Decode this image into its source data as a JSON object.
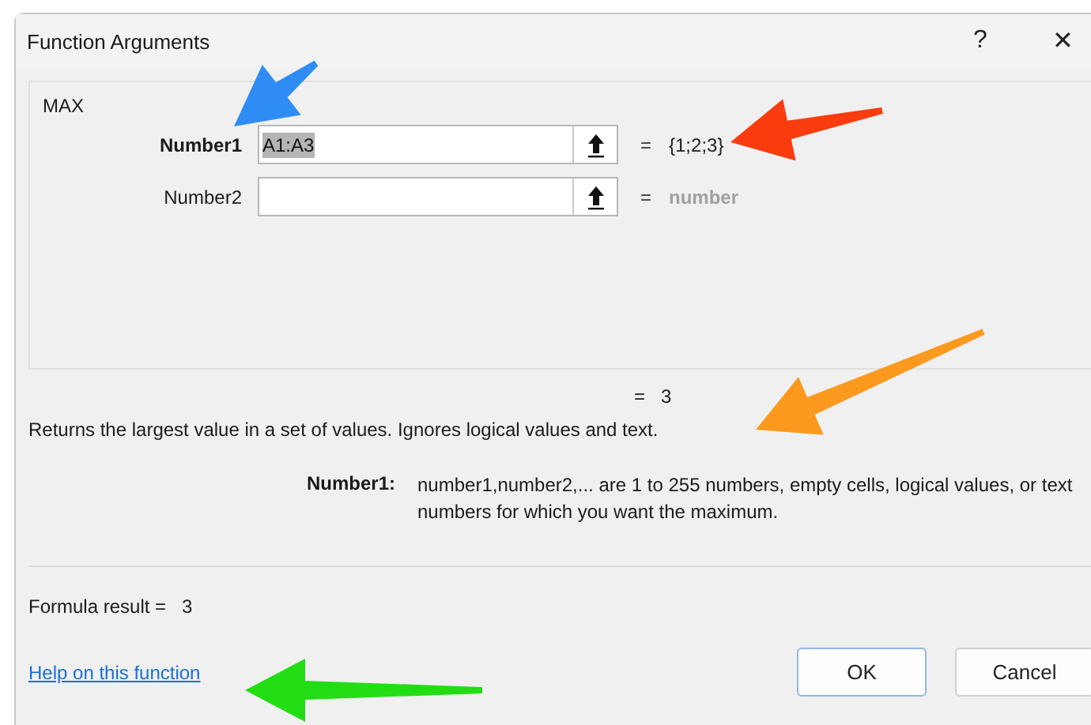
{
  "window": {
    "title": "Function Arguments",
    "help": "?",
    "close": "✕"
  },
  "function_name": "MAX",
  "arguments": [
    {
      "label": "Number1",
      "bold": true,
      "value": "A1:A3",
      "value_selected": true,
      "equals": "=",
      "result": "{1;2;3}",
      "result_muted": false
    },
    {
      "label": "Number2",
      "bold": false,
      "equals": "=",
      "result": "number",
      "result_muted": true
    }
  ],
  "result_line": {
    "equals": "=",
    "value": "3"
  },
  "description": "Returns the largest value in a set of values. Ignores logical values and text.",
  "argument_help": {
    "label": "Number1:",
    "text": "number1,number2,... are 1 to 255 numbers, empty cells, logical values, or text numbers for which you want the maximum."
  },
  "formula_result": {
    "label": "Formula result =",
    "value": "3"
  },
  "help_link": "Help on this function",
  "buttons": [
    {
      "label": "OK",
      "default": true
    },
    {
      "label": "Cancel",
      "default": false
    }
  ],
  "annotations": [
    {
      "kind": "arrow",
      "color": "#2f8cf5"
    },
    {
      "kind": "arrow",
      "color": "#fa3c0f"
    },
    {
      "kind": "arrow",
      "color": "#fb9a1e"
    },
    {
      "kind": "arrow",
      "color": "#22dd14"
    }
  ]
}
